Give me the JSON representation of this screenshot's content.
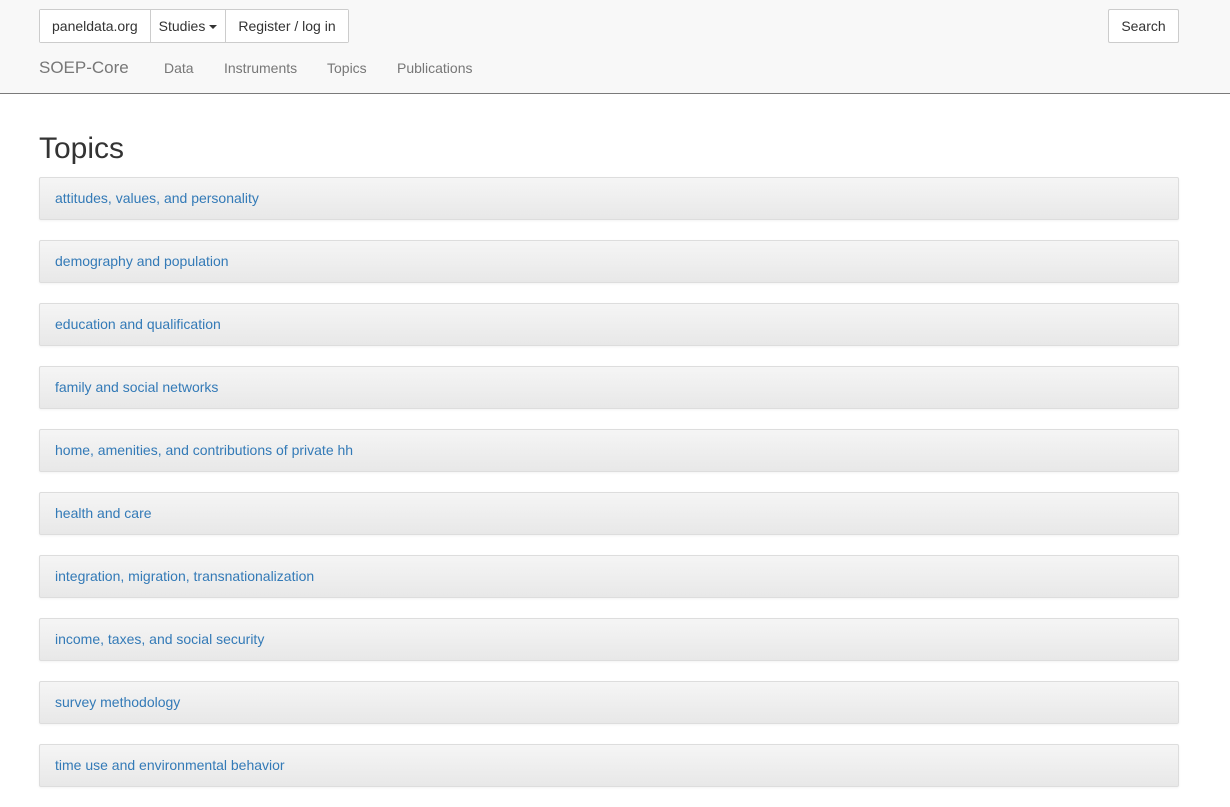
{
  "header": {
    "site_button": "paneldata.org",
    "studies_button": "Studies",
    "register_button": "Register / log in",
    "search_button": "Search",
    "brand": "SOEP-Core",
    "nav": [
      "Data",
      "Instruments",
      "Topics",
      "Publications"
    ]
  },
  "page": {
    "title": "Topics"
  },
  "topics": [
    "attitudes, values, and personality",
    "demography and population",
    "education and qualification",
    "family and social networks",
    "home, amenities, and contributions of private hh",
    "health and care",
    "integration, migration, transnationalization",
    "income, taxes, and social security",
    "survey methodology",
    "time use and environmental behavior"
  ],
  "colors": {
    "link": "#337ab7",
    "navbar_bg": "#f8f8f8",
    "nav_text": "#777777"
  }
}
